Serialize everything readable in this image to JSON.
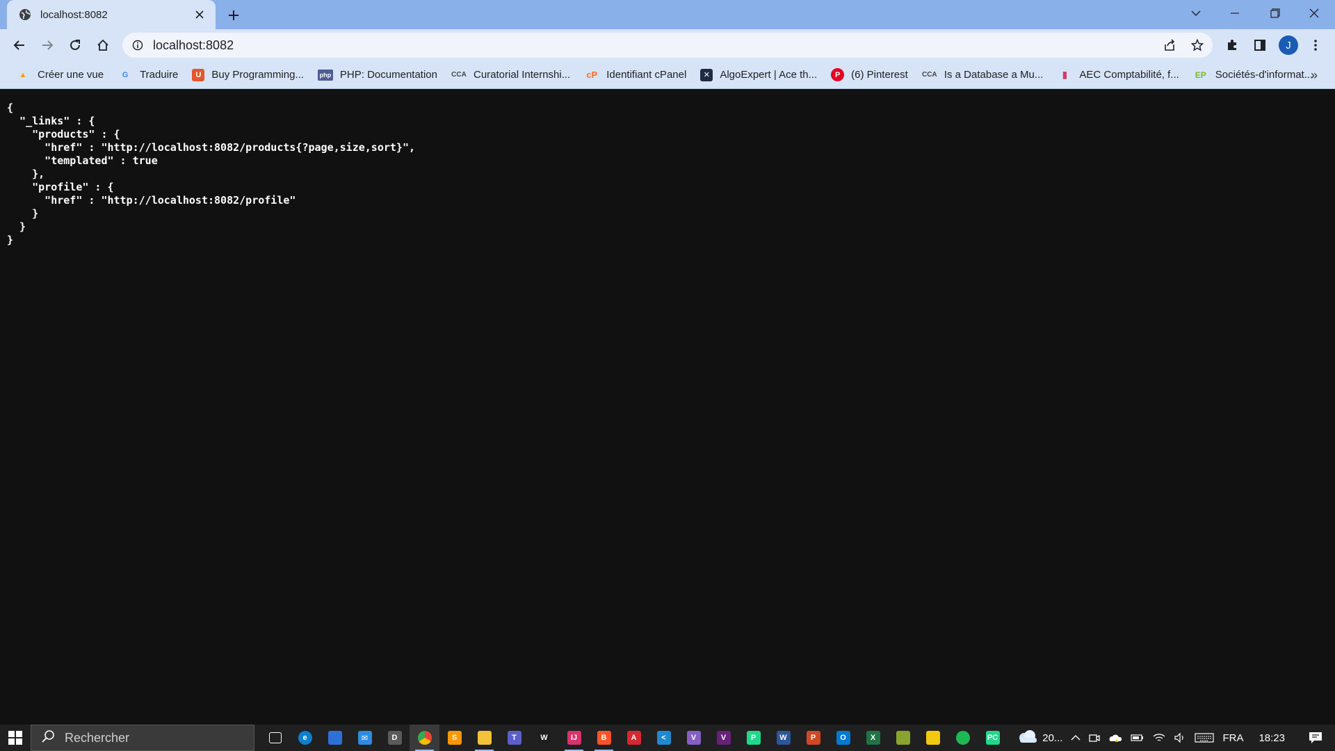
{
  "browser": {
    "tab": {
      "title": "localhost:8082",
      "favicon": "globe-icon"
    },
    "address": {
      "url": "localhost:8082"
    },
    "profile_initial": "J",
    "accent": "#8ab0ea"
  },
  "bookmarks": [
    {
      "label": "Créer une vue",
      "icon": "aws-icon",
      "color": "#ff9900"
    },
    {
      "label": "Traduire",
      "icon": "translate-icon",
      "color": "#4285f4"
    },
    {
      "label": "Buy Programming...",
      "icon": "udemy-icon",
      "color": "#e4572e"
    },
    {
      "label": "PHP: Documentation",
      "icon": "php-icon",
      "color": "#4f5b93"
    },
    {
      "label": "Curatorial Internshi...",
      "icon": "cca-icon",
      "color": "#444444"
    },
    {
      "label": "Identifiant cPanel",
      "icon": "cpanel-icon",
      "color": "#ff6c2c"
    },
    {
      "label": "AlgoExpert | Ace th...",
      "icon": "algoexpert-icon",
      "color": "#1f2a44"
    },
    {
      "label": "(6) Pinterest",
      "icon": "pinterest-icon",
      "color": "#e60023"
    },
    {
      "label": "Is a Database a Mu...",
      "icon": "cca-icon",
      "color": "#444444"
    },
    {
      "label": "AEC Comptabilité, f...",
      "icon": "aec-icon",
      "color": "#d9366a"
    },
    {
      "label": "Sociétés-d'informat...",
      "icon": "ep-icon",
      "color": "#7ab929"
    }
  ],
  "json_lines": [
    "{",
    "  \"_links\" : {",
    "    \"products\" : {",
    "      \"href\" : \"http://localhost:8082/products{?page,size,sort}\",",
    "      \"templated\" : true",
    "    },",
    "    \"profile\" : {",
    "      \"href\" : \"http://localhost:8082/profile\"",
    "    }",
    "  }",
    "}"
  ],
  "taskbar": {
    "search_label": "Rechercher",
    "apps": [
      {
        "name": "task-view-icon",
        "color": "#202020",
        "glyph": ""
      },
      {
        "name": "edge-icon",
        "color": "#0c7fd0",
        "glyph": "e"
      },
      {
        "name": "store-icon",
        "color": "#2f6fd8",
        "glyph": ""
      },
      {
        "name": "mail-icon",
        "color": "#2d8ce0",
        "glyph": "✉"
      },
      {
        "name": "dell-icon",
        "color": "#5a5a5a",
        "glyph": "D"
      },
      {
        "name": "chrome-icon",
        "color": "#e8a117",
        "glyph": ""
      },
      {
        "name": "sublime-icon",
        "color": "#ff9800",
        "glyph": "S"
      },
      {
        "name": "explorer-icon",
        "color": "#f2c23a",
        "glyph": ""
      },
      {
        "name": "teams-icon",
        "color": "#5b5fc7",
        "glyph": "T"
      },
      {
        "name": "wordpress-icon",
        "color": "#1e1e1e",
        "glyph": "W"
      },
      {
        "name": "intellij-icon",
        "color": "#d6336c",
        "glyph": "IJ"
      },
      {
        "name": "brave-icon",
        "color": "#fb542b",
        "glyph": "B"
      },
      {
        "name": "acrobat-icon",
        "color": "#d7282f",
        "glyph": "A"
      },
      {
        "name": "vscode-icon",
        "color": "#1f8ad2",
        "glyph": "<"
      },
      {
        "name": "visualstudio-icon",
        "color": "#865fc5",
        "glyph": "V"
      },
      {
        "name": "visualstudio-preview-icon",
        "color": "#68217a",
        "glyph": "V"
      },
      {
        "name": "pycharm-icon",
        "color": "#21d789",
        "glyph": "P"
      },
      {
        "name": "word-icon",
        "color": "#2b579a",
        "glyph": "W"
      },
      {
        "name": "powerpoint-icon",
        "color": "#d24726",
        "glyph": "P"
      },
      {
        "name": "outlook-icon",
        "color": "#0078d4",
        "glyph": "O"
      },
      {
        "name": "excel-icon",
        "color": "#217346",
        "glyph": "X"
      },
      {
        "name": "minecraft-icon",
        "color": "#8aa32f",
        "glyph": ""
      },
      {
        "name": "powerbi-icon",
        "color": "#f2c811",
        "glyph": ""
      },
      {
        "name": "spotify-icon",
        "color": "#1db954",
        "glyph": ""
      },
      {
        "name": "pycharm-ce-icon",
        "color": "#21d789",
        "glyph": "PC"
      }
    ],
    "weather_text": "20...",
    "language": "FRA",
    "time": "18:23"
  }
}
